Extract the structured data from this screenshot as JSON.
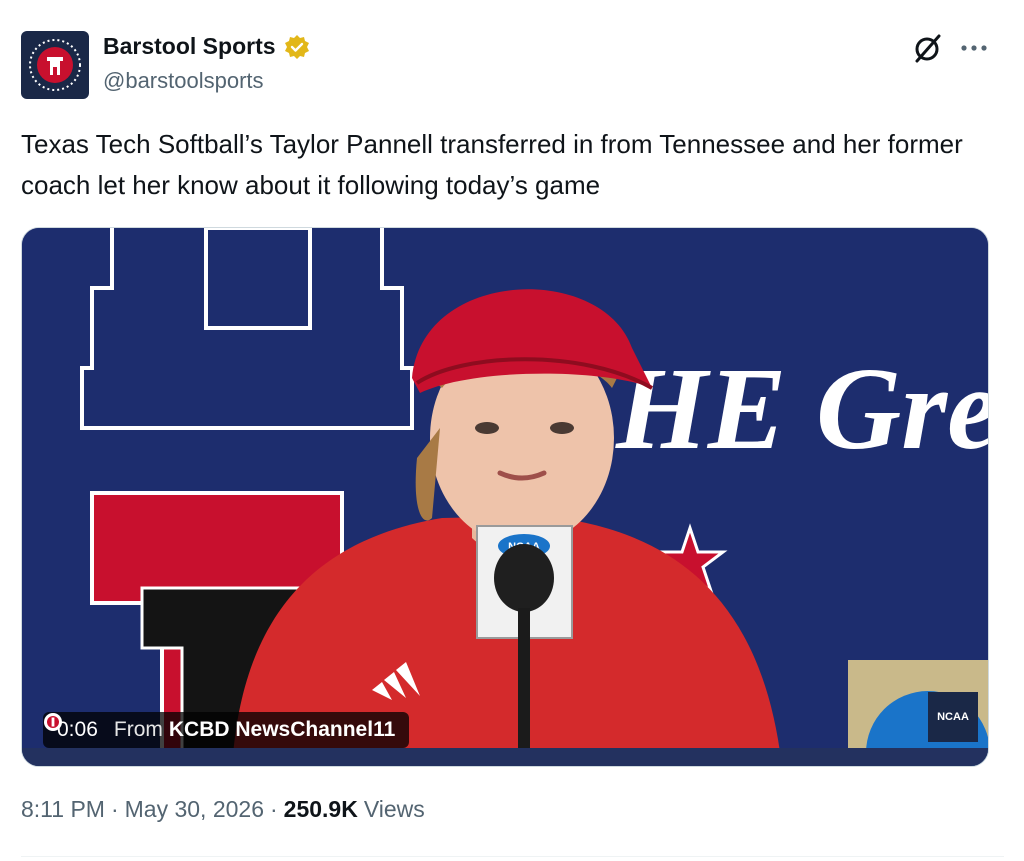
{
  "author": {
    "display_name": "Barstool Sports",
    "handle": "@barstoolsports",
    "verified_badge": "gold-verified-badge",
    "avatar_icon": "barstool-logo"
  },
  "header_actions": {
    "grok_icon": "grok-icon",
    "more_icon": "more-icon"
  },
  "tweet": {
    "text": "Texas Tech Softball’s Taylor Pannell transferred in from Tennessee and her former coach let her know about it following today’s game"
  },
  "video": {
    "time": "0:06",
    "from_label": "From",
    "source": "KCBD NewsChannel11",
    "mic_flag": "NCAA",
    "corner_badge": "NCAA",
    "backdrop_text": "HE Gre"
  },
  "meta": {
    "time": "8:11 PM",
    "separator": "·",
    "date": "May 30, 2026",
    "views_count": "250.9K",
    "views_label": "Views"
  },
  "colors": {
    "text_primary": "#0f1419",
    "text_secondary": "#536471",
    "verified_gold": "#e2b719",
    "backdrop_blue": "#1d2d6e",
    "texas_tech_red": "#cc1f2a"
  }
}
